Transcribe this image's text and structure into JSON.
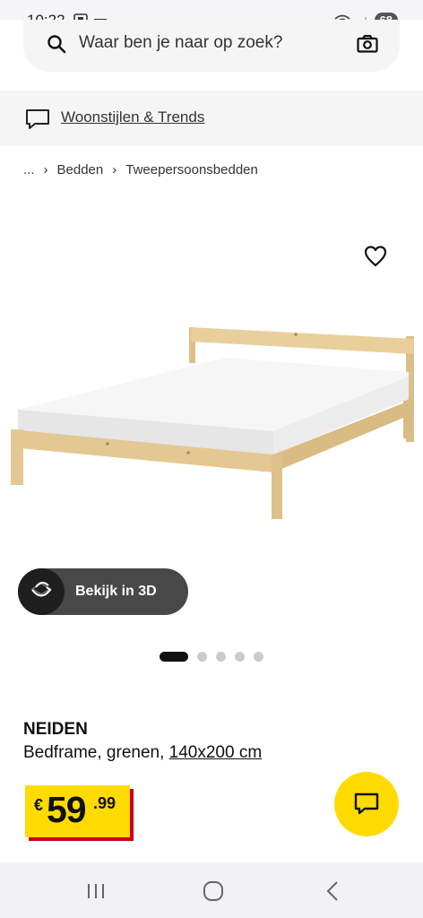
{
  "status_bar": {
    "time": "10:22",
    "battery": "68"
  },
  "search": {
    "placeholder": "Waar ben je naar op zoek?"
  },
  "trends": {
    "label": "Woonstijlen & Trends"
  },
  "breadcrumb": {
    "ellipsis": "...",
    "items": [
      "Bedden",
      "Tweepersoonsbedden"
    ]
  },
  "view3d": {
    "label": "Bekijk in 3D"
  },
  "carousel": {
    "count": 5,
    "active": 0
  },
  "product": {
    "name": "NEIDEN",
    "desc_prefix": "Bedframe, grenen, ",
    "size": "140x200 cm"
  },
  "price": {
    "currency": "€",
    "integer": "59",
    "decimal": ".99"
  },
  "colors": {
    "ikea_yellow": "#ffdb00",
    "price_shadow": "#cc0008",
    "pine": "#e9cf9c"
  },
  "icons": [
    "search-icon",
    "camera-icon",
    "chat-bubble-icon",
    "heart-icon",
    "rotate-3d-icon",
    "chat-icon"
  ]
}
